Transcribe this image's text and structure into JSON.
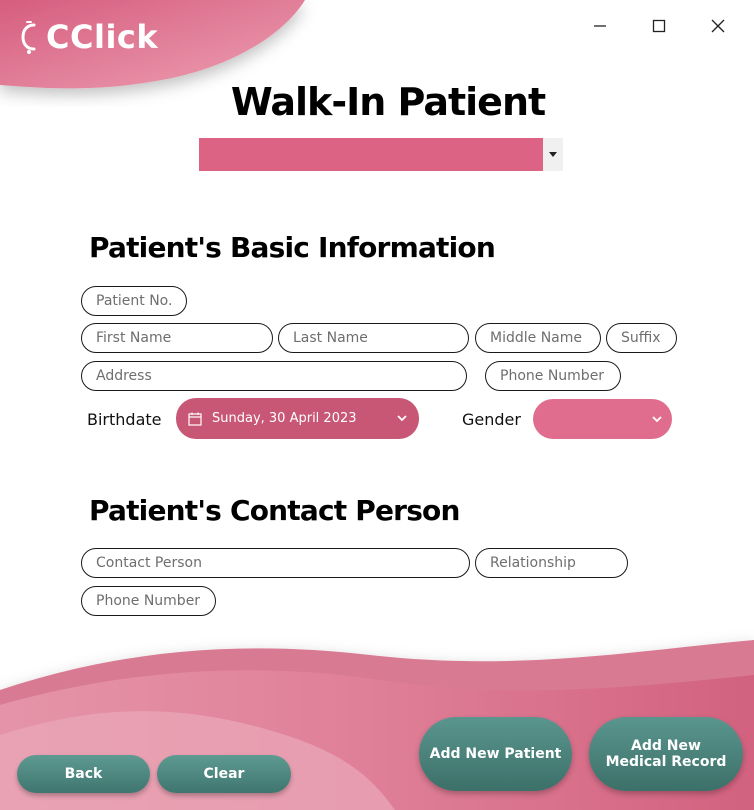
{
  "app": {
    "name": "CClick"
  },
  "window_controls": {
    "minimize": "—",
    "maximize": "☐",
    "close": "✕"
  },
  "page": {
    "title": "Walk-In Patient"
  },
  "top_combo": {
    "value": ""
  },
  "basic_info": {
    "heading": "Patient's Basic Information",
    "patient_no_placeholder": "Patient No.",
    "first_name_placeholder": "First Name",
    "last_name_placeholder": "Last Name",
    "middle_name_placeholder": "Middle Name",
    "suffix_placeholder": "Suffix",
    "address_placeholder": "Address",
    "phone_placeholder": "Phone Number",
    "birthdate_label": "Birthdate",
    "birthdate_value": "Sunday, 30 April 2023",
    "gender_label": "Gender",
    "gender_value": ""
  },
  "contact": {
    "heading": "Patient's Contact Person",
    "contact_person_placeholder": "Contact Person",
    "relationship_placeholder": "Relationship",
    "phone_placeholder": "Phone Number"
  },
  "buttons": {
    "back": "Back",
    "clear": "Clear",
    "add_patient": "Add New Patient",
    "add_record": "Add New Medical Record"
  },
  "colors": {
    "brand_pink": "#dc6383",
    "dark_pink": "#c85775",
    "teal": "#4a847c"
  }
}
